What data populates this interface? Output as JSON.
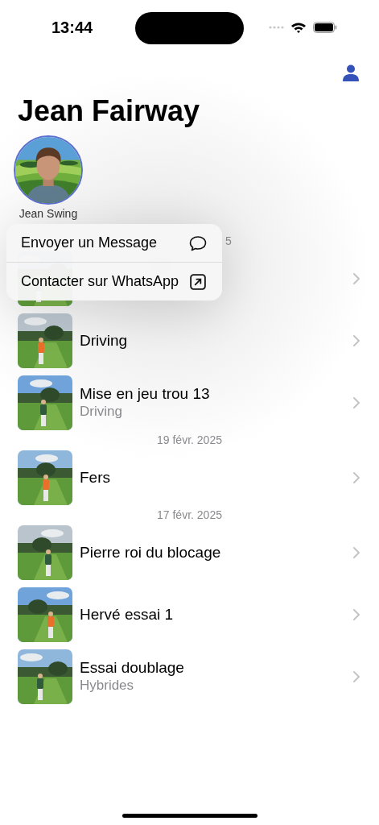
{
  "status_bar": {
    "time": "13:44"
  },
  "title": "Jean Fairway",
  "profile": {
    "name": "Jean Swing"
  },
  "context_menu": {
    "items": [
      {
        "label": "Envoyer un Message",
        "kind": "message"
      },
      {
        "label": "Contacter sur WhatsApp",
        "kind": "link"
      }
    ]
  },
  "feed": [
    {
      "kind": "date",
      "text": "5"
    },
    {
      "kind": "session"
    },
    {
      "kind": "session",
      "title": "Driving"
    },
    {
      "kind": "session",
      "title": "Mise en jeu trou 13",
      "subtitle": "Driving"
    },
    {
      "kind": "date",
      "text": "19 févr. 2025"
    },
    {
      "kind": "session",
      "title": "Fers"
    },
    {
      "kind": "date",
      "text": "17 févr. 2025"
    },
    {
      "kind": "session",
      "title": "Pierre roi du blocage"
    },
    {
      "kind": "session",
      "title": "Hervé essai 1"
    },
    {
      "kind": "session",
      "title": "Essai doublage",
      "subtitle": "Hybrides"
    }
  ]
}
